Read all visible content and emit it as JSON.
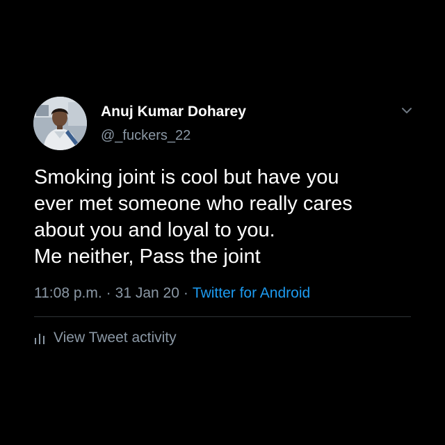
{
  "tweet": {
    "author": {
      "display_name": "Anuj Kumar Doharey",
      "handle": "@_fuckers_22",
      "avatar_icon": "profile-photo"
    },
    "menu_icon": "chevron-down-icon",
    "text_lines": [
      "Smoking joint is cool but have you",
      "ever met someone who really cares",
      "about you and loyal to you.",
      "Me neither, Pass the joint"
    ],
    "time": "11:08 p.m.",
    "separator": "·",
    "date": "31 Jan 20",
    "source": "Twitter for Android",
    "activity": {
      "icon": "bar-chart-icon",
      "label": "View Tweet activity"
    }
  },
  "colors": {
    "background": "#000000",
    "text_primary": "#ffffff",
    "text_secondary": "#8b98a5",
    "link": "#1d9bf0",
    "divider": "#2f3336"
  }
}
